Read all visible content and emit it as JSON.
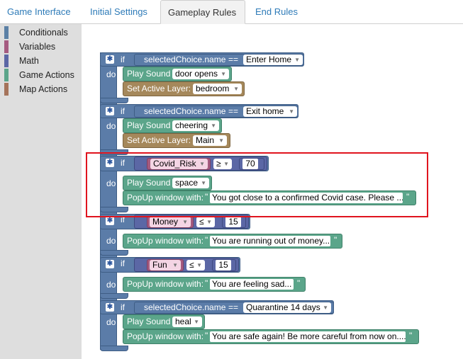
{
  "tabs": [
    {
      "label": "Game Interface"
    },
    {
      "label": "Initial Settings"
    },
    {
      "label": "Gameplay Rules"
    },
    {
      "label": "End Rules"
    }
  ],
  "toolbox": [
    {
      "label": "Conditionals",
      "color": "#5b80a5"
    },
    {
      "label": "Variables",
      "color": "#a55b80"
    },
    {
      "label": "Math",
      "color": "#5b67a5"
    },
    {
      "label": "Game Actions",
      "color": "#5ba58a"
    },
    {
      "label": "Map Actions",
      "color": "#a5745b"
    }
  ],
  "keywords": {
    "if": "if",
    "do": "do",
    "play_sound": "Play Sound",
    "set_active_layer": "Set Active Layer:",
    "popup": "PopUp window with:",
    "quote": "\"",
    "selected_choice": "selectedChoice.name",
    "equals": "=="
  },
  "rules": [
    {
      "condition": "Enter Home",
      "sound": "door opens",
      "layer": "bedroom"
    },
    {
      "condition": "Exit home",
      "sound": "cheering",
      "layer": "Main"
    },
    {
      "variable": "Covid_Risk",
      "operator": "≥",
      "value": "70",
      "sound": "space",
      "popup": "You got close to a confirmed Covid case. Please ..."
    },
    {
      "variable": "Money",
      "operator": "≤",
      "value": "15",
      "popup": "You are running out of money..."
    },
    {
      "variable": "Fun",
      "operator": "≤",
      "value": "15",
      "popup": "You are feeling sad..."
    },
    {
      "condition": "Quarantine 14 days",
      "sound": "heal",
      "popup": "You are safe again! Be more careful from now on...."
    }
  ],
  "icons": {
    "gear": "gear-icon",
    "dropdown": "chevron-down-icon"
  },
  "highlight_color": "#e0141e"
}
